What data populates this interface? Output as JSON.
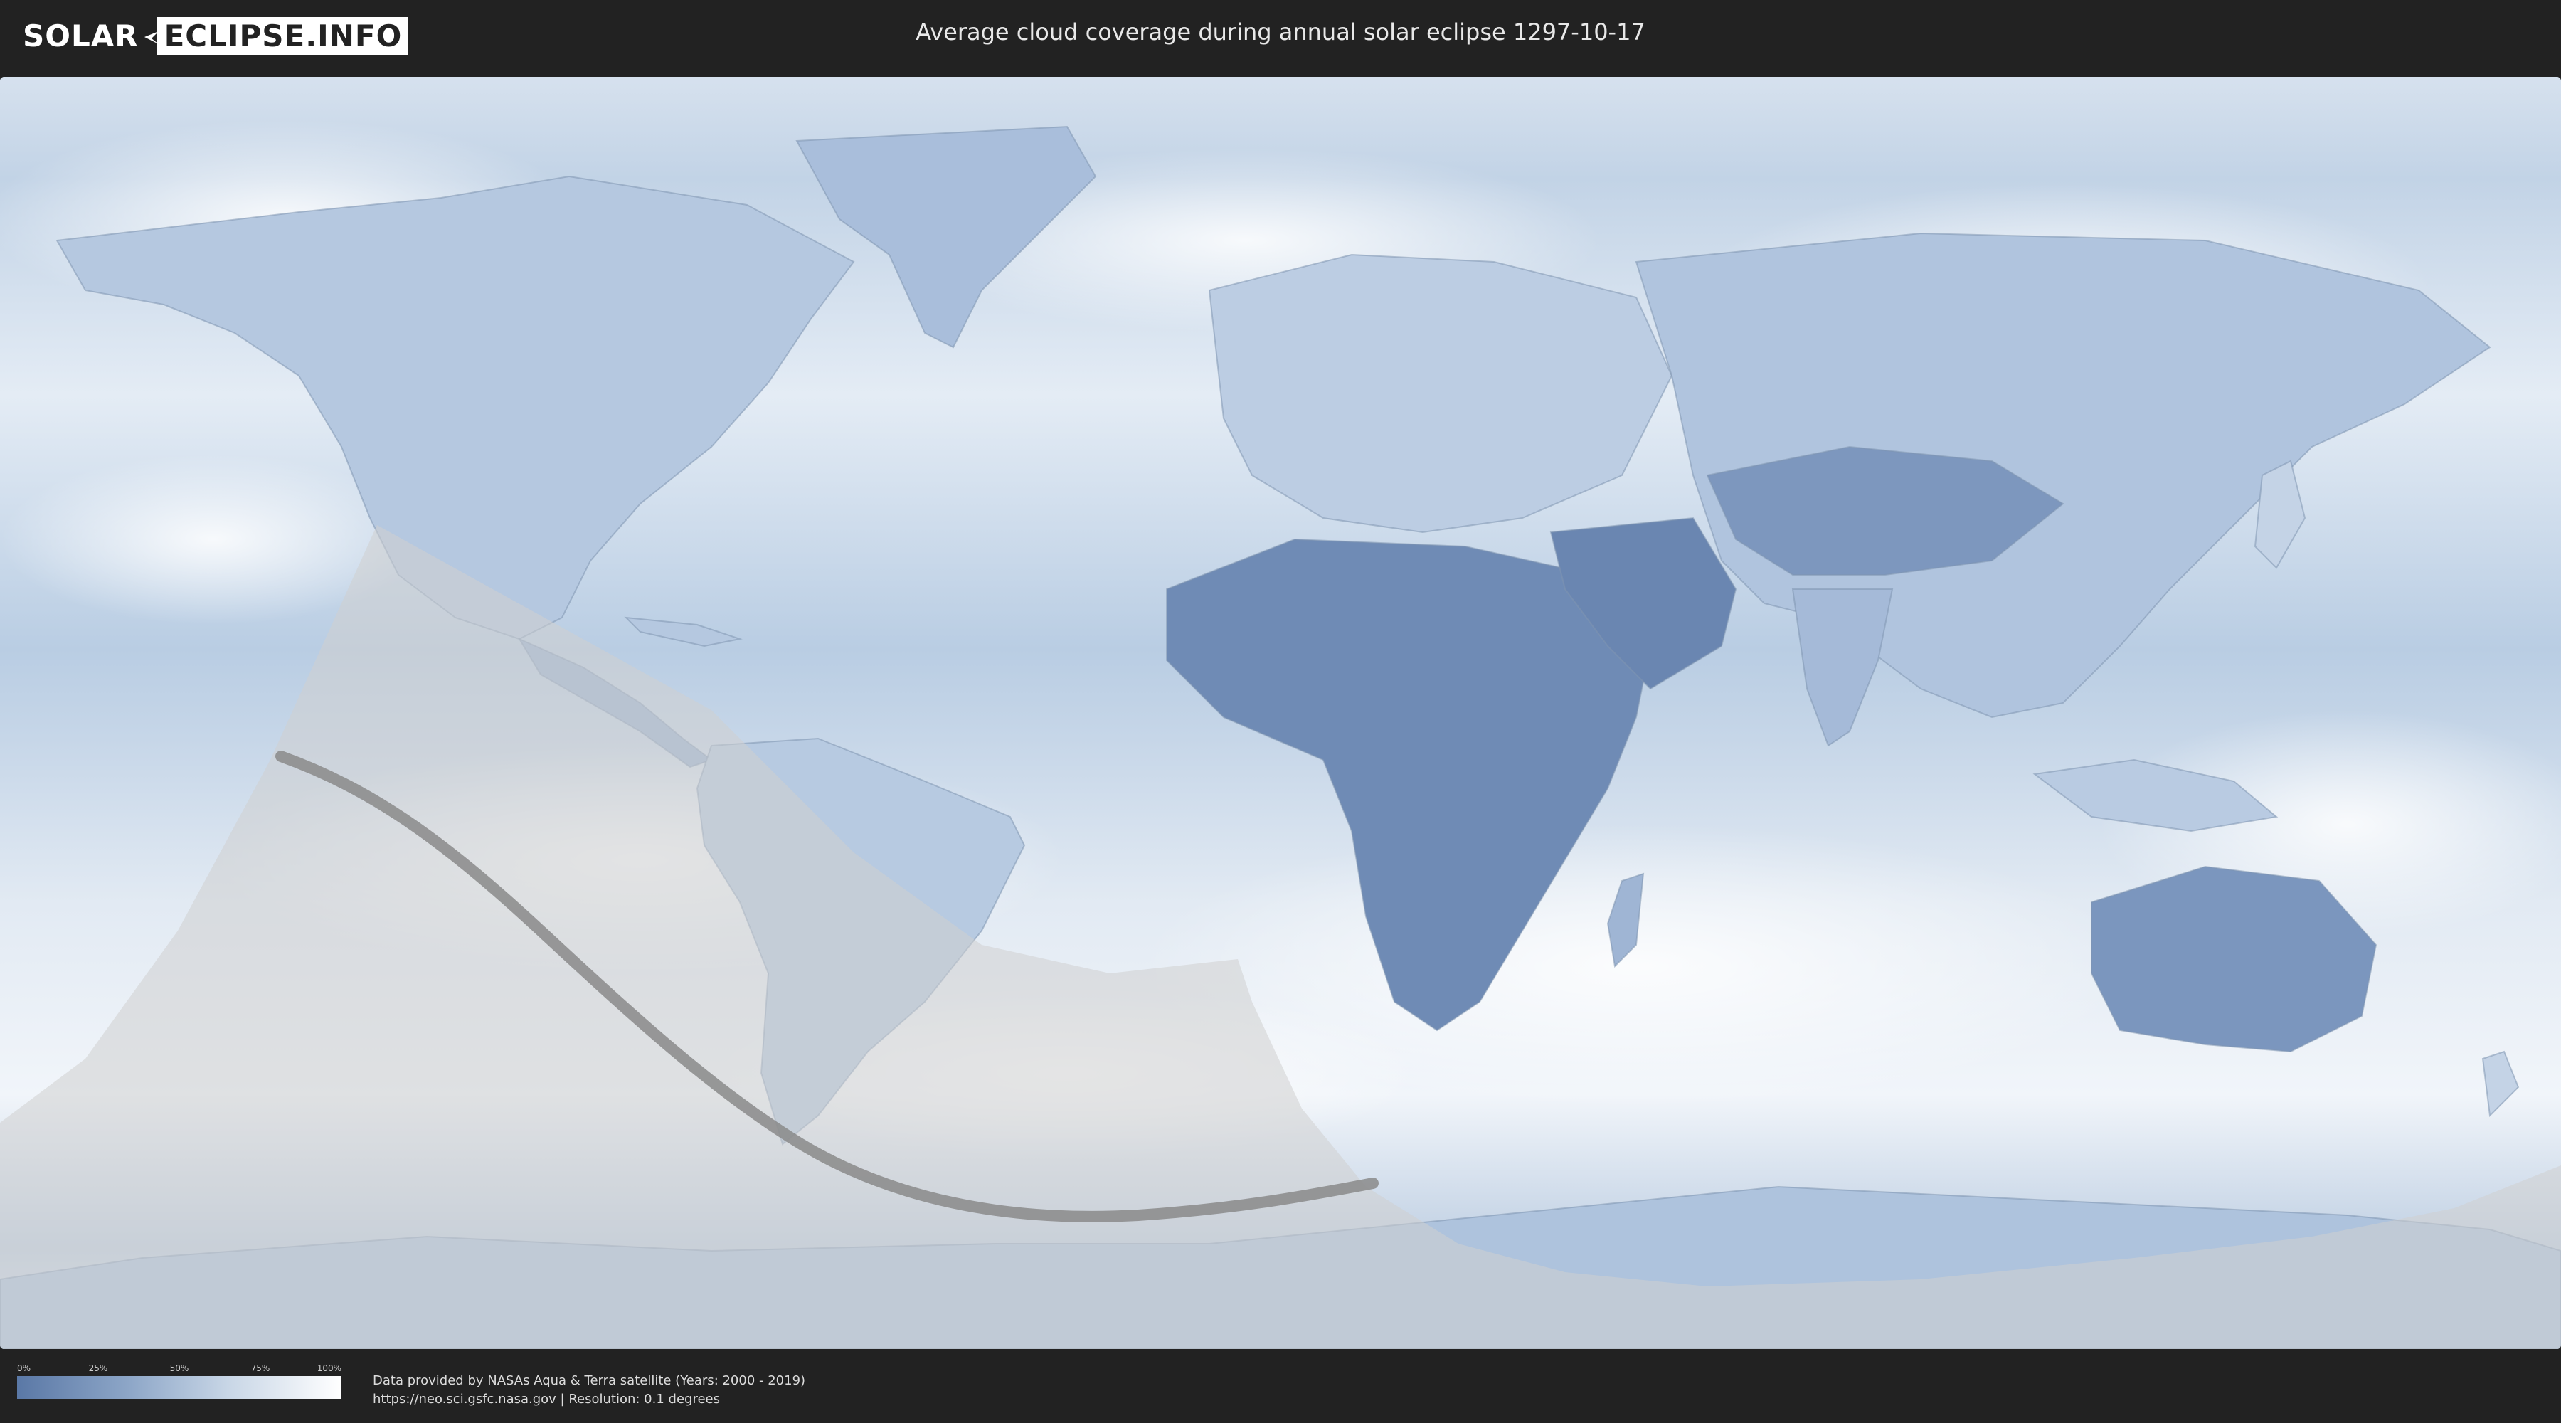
{
  "header": {
    "logo": {
      "part1": "SOLAR",
      "part2": "ECLIPSE.INFO"
    },
    "title": "Average cloud coverage during annual solar eclipse 1297-10-17"
  },
  "map": {
    "projection": "equirectangular",
    "layer": "average-cloud-coverage",
    "eclipse_type": "annular",
    "colors": {
      "cloud_low": "#5a78a6",
      "cloud_high": "#ffffff",
      "penumbra_overlay": "#cfcfcf",
      "central_path": "#8a8a8a"
    }
  },
  "legend": {
    "ticks": [
      "0%",
      "25%",
      "50%",
      "75%",
      "100%"
    ]
  },
  "footer": {
    "credit_line1": "Data provided by NASAs Aqua & Terra satellite (Years: 2000 - 2019)",
    "credit_line2": "https://neo.sci.gsfc.nasa.gov | Resolution: 0.1 degrees"
  }
}
